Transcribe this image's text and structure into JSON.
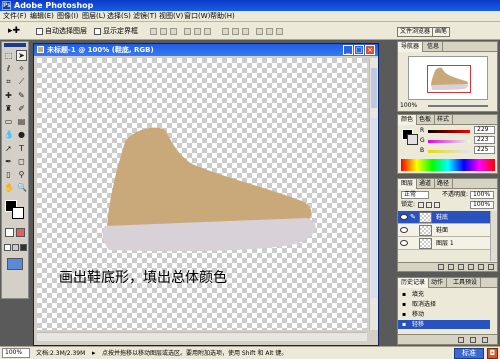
{
  "window": {
    "title": "Adobe Photoshop",
    "app_icon": "Ps"
  },
  "menu": [
    "文件(F)",
    "编辑(E)",
    "图像(I)",
    "图层(L)",
    "选择(S)",
    "滤镜(T)",
    "视图(V)",
    "窗口(W)",
    "帮助(H)"
  ],
  "options_bar": {
    "auto_select_label": "自动选择图层",
    "show_bounds_label": "显示定界框",
    "tabs": [
      "文件浏览器",
      "画笔"
    ]
  },
  "document": {
    "title": "未标题-1 @ 100% (鞋底, RGB)",
    "caption": "画出鞋底形，填出总体颜色",
    "shoe_color": "#C9A97A",
    "sole_color": "#D8D2D8"
  },
  "navigator": {
    "tabs": [
      "导航器",
      "信息"
    ],
    "zoom": "100%"
  },
  "color_panel": {
    "tabs": [
      "颜色",
      "色板",
      "样式"
    ],
    "channels": [
      {
        "label": "R",
        "value": "229"
      },
      {
        "label": "G",
        "value": "223"
      },
      {
        "label": "B",
        "value": "225"
      }
    ]
  },
  "layers_panel": {
    "tabs": [
      "图层",
      "通道",
      "路径"
    ],
    "blend_mode": "正常",
    "opacity_label": "不透明度:",
    "opacity_value": "100%",
    "lock_label": "锁定:",
    "fill_value": "100%",
    "layers": [
      {
        "name": "鞋底",
        "selected": true
      },
      {
        "name": "鞋面",
        "selected": false
      },
      {
        "name": "图层 1",
        "selected": false
      }
    ]
  },
  "history_panel": {
    "tabs": [
      "历史记录",
      "动作",
      "工具预设"
    ],
    "items": [
      {
        "label": "填充",
        "selected": false
      },
      {
        "label": "取消选择",
        "selected": false
      },
      {
        "label": "移动",
        "selected": false
      },
      {
        "label": "轻移",
        "selected": true
      }
    ]
  },
  "status": {
    "zoom": "100%",
    "doc_info": "文档:2.3M/2.39M",
    "hint": "点按并拖移以移动图层或选区。要用附加选项，使用 Shift 和 Alt 键。",
    "mode_label": "标准"
  }
}
